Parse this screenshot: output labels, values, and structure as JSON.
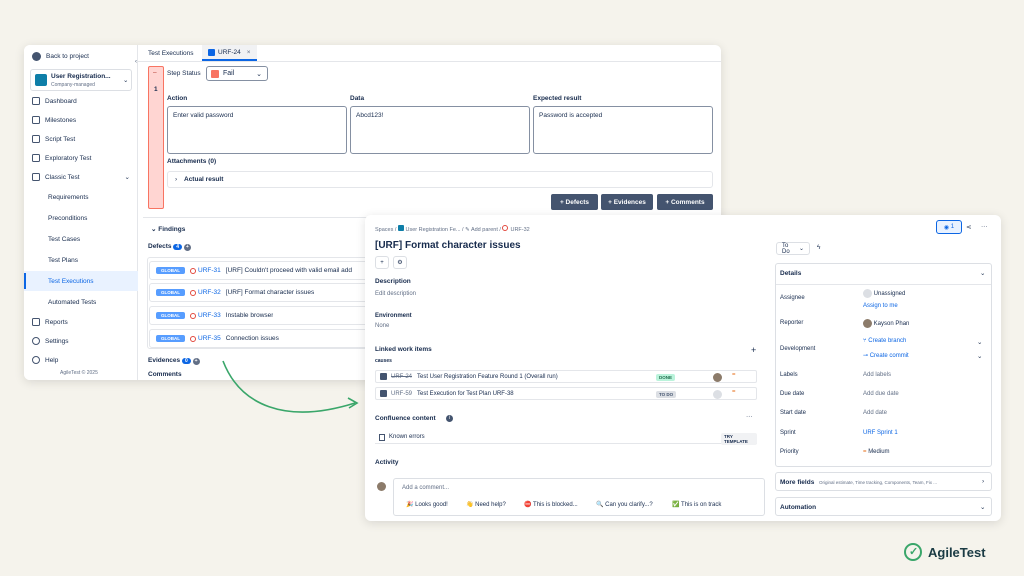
{
  "sidebar": {
    "back": "Back to project",
    "project_name": "User Registration...",
    "project_type": "Company-managed",
    "items": [
      {
        "label": "Dashboard"
      },
      {
        "label": "Milestones"
      },
      {
        "label": "Script Test"
      },
      {
        "label": "Exploratory Test"
      },
      {
        "label": "Classic Test"
      }
    ],
    "sub_items": [
      {
        "label": "Requirements"
      },
      {
        "label": "Preconditions"
      },
      {
        "label": "Test Cases"
      },
      {
        "label": "Test Plans"
      },
      {
        "label": "Test Executions"
      },
      {
        "label": "Automated Tests"
      }
    ],
    "bottom": [
      {
        "label": "Reports"
      },
      {
        "label": "Settings"
      },
      {
        "label": "Help"
      }
    ],
    "footer": "AgileTest © 2025"
  },
  "tabs": {
    "tab1": "Test Executions",
    "tab2": "URF-24"
  },
  "step": {
    "number": "1",
    "status_label": "Step Status",
    "status_value": "Fail",
    "status_color": "#f87462",
    "action_label": "Action",
    "action_value": "Enter valid password",
    "data_label": "Data",
    "data_value": "Abcd123!",
    "expected_label": "Expected result",
    "expected_value": "Password is accepted",
    "attachments": "Attachments (0)",
    "actual": "Actual result"
  },
  "buttons": {
    "defects": "+ Defects",
    "evidences": "+ Evidences",
    "comments": "+ Comments"
  },
  "findings": {
    "title": "Findings",
    "defects_label": "Defects",
    "defects_count": "4",
    "global": "GLOBAL",
    "rows": [
      {
        "key": "URF-31",
        "text": "[URF] Couldn't proceed with valid email add"
      },
      {
        "key": "URF-32",
        "text": "[URF] Format character issues"
      },
      {
        "key": "URF-33",
        "text": "Instable browser"
      },
      {
        "key": "URF-35",
        "text": "Connection issues"
      }
    ],
    "evidences_label": "Evidences",
    "evidences_count": "0",
    "comments_label": "Comments"
  },
  "issue": {
    "bc_spaces": "Spaces",
    "bc_project": "User Registration Fe...",
    "bc_parent": "Add parent",
    "bc_key": "URF-32",
    "title": "[URF] Format character issues",
    "desc_label": "Description",
    "desc_value": "Edit description",
    "env_label": "Environment",
    "env_value": "None",
    "linked_label": "Linked work items",
    "causes": "causes",
    "linked": [
      {
        "key": "URF-24",
        "summary": "Test User Registration Feature Round 1 (Overall run)",
        "status": "DONE"
      },
      {
        "key": "URF-59",
        "summary": "Test Execution for Test Plan URF-38",
        "status": "TO DO"
      }
    ],
    "conf_label": "Confluence content",
    "conf_item": "Known errors",
    "try_template": "TRY TEMPLATE",
    "activity": "Activity",
    "comment_placeholder": "Add a comment...",
    "quick": [
      "🎉 Looks good!",
      "👋 Need help?",
      "⛔ This is blocked...",
      "🔍 Can you clarify...?",
      "✅ This is on track"
    ]
  },
  "details": {
    "status": "To Do",
    "watch": "1",
    "title": "Details",
    "assignee_label": "Assignee",
    "assignee_value": "Unassigned",
    "assign_me": "Assign to me",
    "reporter_label": "Reporter",
    "reporter_value": "Kayson Phan",
    "dev_label": "Development",
    "dev_branch": "Create branch",
    "dev_commit": "Create commit",
    "labels_label": "Labels",
    "labels_value": "Add labels",
    "due_label": "Due date",
    "due_value": "Add due date",
    "start_label": "Start date",
    "start_value": "Add date",
    "sprint_label": "Sprint",
    "sprint_value": "URF Sprint 1",
    "priority_label": "Priority",
    "priority_value": "Medium",
    "more_fields": "More fields",
    "more_hint": "Original estimate, Time tracking, Components, Team, Fix ...",
    "automation": "Automation"
  },
  "brand": "AgileTest"
}
